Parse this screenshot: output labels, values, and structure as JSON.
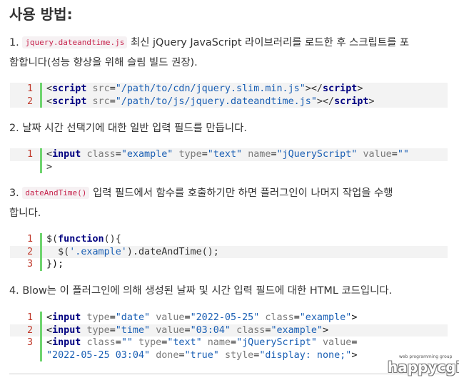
{
  "heading": "사용 방법:",
  "steps": [
    {
      "num": "1.",
      "code_inline": "jquery.dateandtime.js",
      "text_a": "최신 jQuery JavaScript 라이브러리를 로드한 후 스크립트를 포",
      "text_b": "함합니다(성능 향상을 위해 슬림 빌드 권장)."
    },
    {
      "num": "2.",
      "text_a": "날짜 시간 선택기에 대한 일반 입력 필드를 만듭니다."
    },
    {
      "num": "3.",
      "code_inline": "dateAndTime()",
      "text_a": "입력 필드에서 함수를 호출하기만 하면 플러그인이 나머지 작업을 수행",
      "text_b": "합니다."
    },
    {
      "num": "4.",
      "text_a": "Blow는 이 플러그인에 의해 생성된 날짜 및 시간 입력 필드에 대한 HTML 코드입니다."
    }
  ],
  "code_blocks": {
    "b1": {
      "n": [
        "1",
        "2"
      ],
      "l1": {
        "open": "<",
        "tag": "script",
        "attr": "src",
        "eq": "=",
        "val": "\"/path/to/cdn/jquery.slim.min.js\"",
        "close": "></",
        "tag2": "script",
        "end": ">"
      },
      "l2": {
        "open": "<",
        "tag": "script",
        "attr": "src",
        "eq": "=",
        "val": "\"/path/to/js/jquery.dateandtime.js\"",
        "close": "></",
        "tag2": "script",
        "end": ">"
      }
    },
    "b2": {
      "n": [
        "1"
      ],
      "open": "<",
      "tag": "input",
      "a1": "class",
      "v1": "\"example\"",
      "a2": "type",
      "v2": "\"text\"",
      "a3": "name",
      "v3": "\"jQueryScript\"",
      "a4": "value",
      "v4": "\"\"",
      "end": ">"
    },
    "b3": {
      "n": [
        "1",
        "2",
        "3"
      ],
      "l1a": "$(",
      "l1k": "function",
      "l1b": "(){",
      "l2a": "  $(",
      "l2s": "'.example'",
      "l2b": ").dateAndTime();",
      "l3": "});"
    },
    "b4": {
      "n": [
        "1",
        "2",
        "3"
      ],
      "r1": {
        "tag": "input",
        "a1": "type",
        "v1": "\"date\"",
        "a2": "value",
        "v2": "\"2022-05-25\"",
        "a3": "class",
        "v3": "\"example\""
      },
      "r2": {
        "tag": "input",
        "a1": "type",
        "v1": "\"time\"",
        "a2": "value",
        "v2": "\"03:04\"",
        "a3": "class",
        "v3": "\"example\""
      },
      "r3": {
        "tag": "input",
        "a1": "class",
        "v1": "\"\"",
        "a2": "type",
        "v2": "\"text\"",
        "a3": "name",
        "v3": "\"jQueryScript\"",
        "a4": "value",
        "v4": "\"2022-05-25 03:04\"",
        "a5": "done",
        "v5": "\"true\"",
        "a6": "style",
        "v6": "\"display: none;\""
      }
    }
  },
  "logo": {
    "tagline": "web programming group",
    "name": "happycgi"
  }
}
